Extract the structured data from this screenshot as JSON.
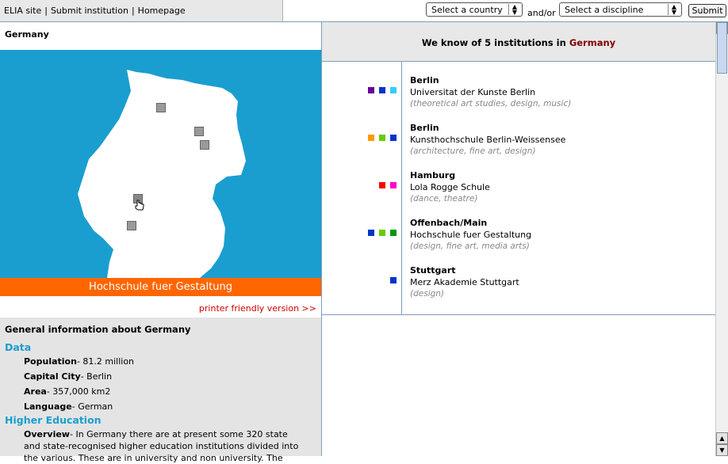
{
  "topbar": {
    "links": [
      "ELIA site",
      "Submit institution",
      "Homepage"
    ],
    "country_select": "Select a country",
    "and_or": "and/or",
    "discipline_select": "Select a discipline",
    "submit_label": "Submit"
  },
  "left": {
    "country_title": "Germany",
    "map_caption": "Hochschule fuer Gestaltung",
    "printer_link": "printer friendly version >>",
    "info_title": "General information about Germany",
    "data_heading": "Data",
    "facts": [
      {
        "label": "Population",
        "value": "- 81.2 million"
      },
      {
        "label": "Capital City",
        "value": "- Berlin"
      },
      {
        "label": "Area",
        "value": "- 357,000 km2"
      },
      {
        "label": "Language",
        "value": "- German"
      }
    ],
    "higher_ed_heading": "Higher Education",
    "overview_label": "Overview",
    "overview_text": "- In Germany there are at present some 320 state and state-recognised higher education institutions divided into the various. These are in university and non university. The"
  },
  "right": {
    "heading_prefix": "We know of 5 institutions in",
    "heading_country": "Germany",
    "institutions": [
      {
        "city": "Berlin",
        "name": "Universitat der Kunste Berlin",
        "disciplines": "(theoretical art studies, design, music)",
        "colors": [
          "#660099",
          "#0033cc",
          "#33ccff"
        ]
      },
      {
        "city": "Berlin",
        "name": "Kunsthochschule Berlin-Weissensee",
        "disciplines": "(architecture, fine art, design)",
        "colors": [
          "#ff9900",
          "#66cc00",
          "#0033cc"
        ]
      },
      {
        "city": "Hamburg",
        "name": "Lola Rogge Schule",
        "disciplines": "(dance, theatre)",
        "colors": [
          "#ff0000",
          "#ff00cc"
        ]
      },
      {
        "city": "Offenbach/Main",
        "name": "Hochschule fuer Gestaltung",
        "disciplines": "(design, fine art, media arts)",
        "colors": [
          "#0033cc",
          "#66cc00",
          "#009900"
        ]
      },
      {
        "city": "Stuttgart",
        "name": "Merz Akademie Stuttgart",
        "disciplines": "(design)",
        "colors": [
          "#0033cc"
        ]
      }
    ]
  },
  "colors": {
    "map_background": "#1a9ecf",
    "caption_background": "#ff6600",
    "accent_heading": "#1a9ecf",
    "printer_link": "#cc0000",
    "country_highlight": "#800000"
  }
}
